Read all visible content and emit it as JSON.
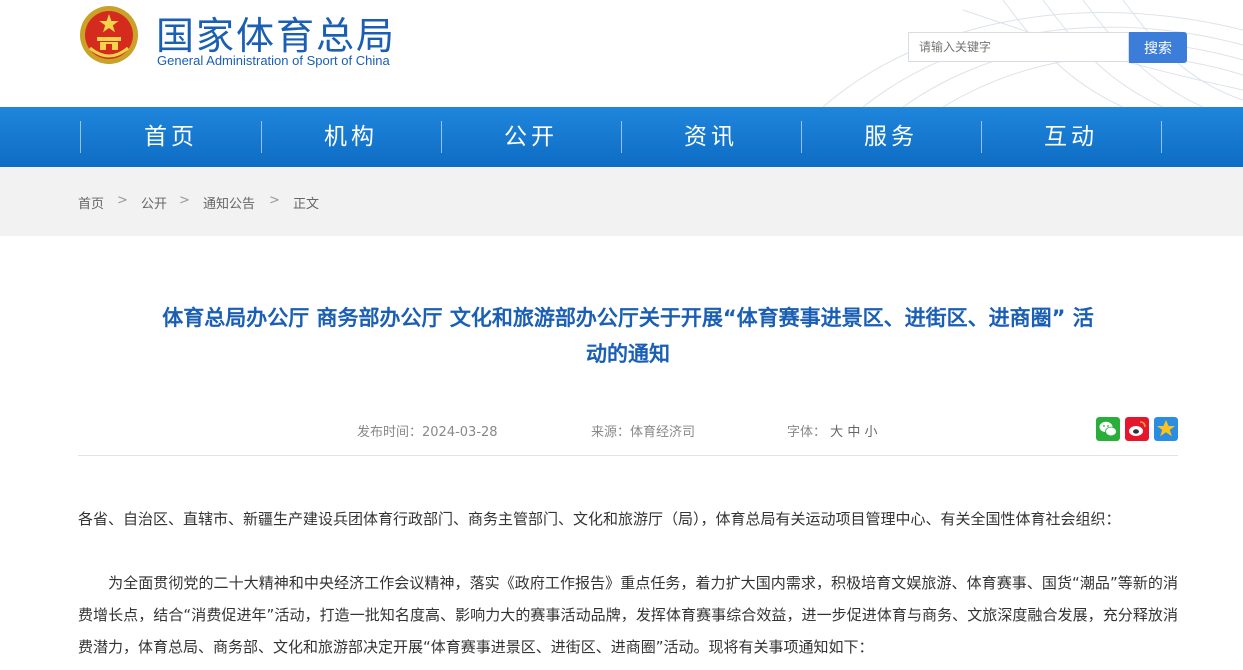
{
  "header": {
    "site_title": "国家体育总局",
    "site_subtitle": "General Administration of Sport of China",
    "search_placeholder": "请输入关键字",
    "search_button": "搜索"
  },
  "nav": {
    "items": [
      "首页",
      "机构",
      "公开",
      "资讯",
      "服务",
      "互动"
    ]
  },
  "breadcrumb": {
    "items": [
      "首页",
      "公开",
      "通知公告",
      "正文"
    ],
    "separator": ">"
  },
  "article": {
    "title_line1": "体育总局办公厅 商务部办公厅 文化和旅游部办公厅关于开展“体育赛事进景区、进街区、进商圈” 活",
    "title_line2": "动的通知",
    "publish_label": "发布时间：",
    "publish_date": "2024-03-28",
    "source_label": "来源：",
    "source_value": "体育经济司",
    "font_label": "字体：",
    "font_large": "大",
    "font_medium": "中",
    "font_small": "小",
    "share_icons": [
      "wechat-icon",
      "weibo-icon",
      "qzone-icon"
    ],
    "paragraphs": [
      "各省、自治区、直辖市、新疆生产建设兵团体育行政部门、商务主管部门、文化和旅游厅（局），体育总局有关运动项目管理中心、有关全国性体育社会组织：",
      "　　为全面贯彻党的二十大精神和中央经济工作会议精神，落实《政府工作报告》重点任务，着力扩大国内需求，积极培育文娱旅游、体育赛事、国货“潮品”等新的消费增长点，结合“消费促进年”活动，打造一批知名度高、影响力大的赛事活动品牌，发挥体育赛事综合效益，进一步促进体育与商务、文旅深度融合发展，充分释放消费潜力，体育总局、商务部、文化和旅游部决定开展“体育赛事进景区、进街区、进商圈”活动。现将有关事项通知如下："
    ]
  },
  "colors": {
    "brand_blue": "#1a5fb4",
    "nav_blue": "#1478d4",
    "crumb_bg": "#f2f2f2"
  }
}
